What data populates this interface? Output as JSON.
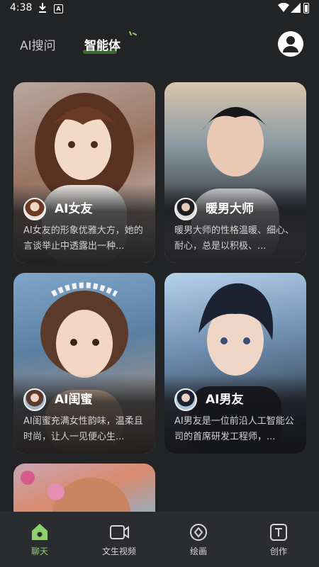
{
  "status": {
    "time": "4:38"
  },
  "tabs": {
    "ai_search": "AI搜问",
    "agent": "智能体"
  },
  "cards": [
    {
      "name": "AI女友",
      "desc": "AI女友的形象优雅大方，她的言谈举止中透露出一种..."
    },
    {
      "name": "暖男大师",
      "desc": "暖男大师的性格温暖、细心、耐心，总是以积极、..."
    },
    {
      "name": "AI闺蜜",
      "desc": "AI闺蜜充满女性韵味，温柔且时尚，让人一见便心生..."
    },
    {
      "name": "AI男友",
      "desc": "AI男友是一位前沿人工智能公司的首席研发工程师，..."
    }
  ],
  "nav": {
    "chat": "聊天",
    "video": "文生视频",
    "paint": "绘画",
    "create": "创作"
  },
  "colors": {
    "accent": "#8ed16d",
    "background": "#222325",
    "nav_bg": "#2b2c2f"
  }
}
